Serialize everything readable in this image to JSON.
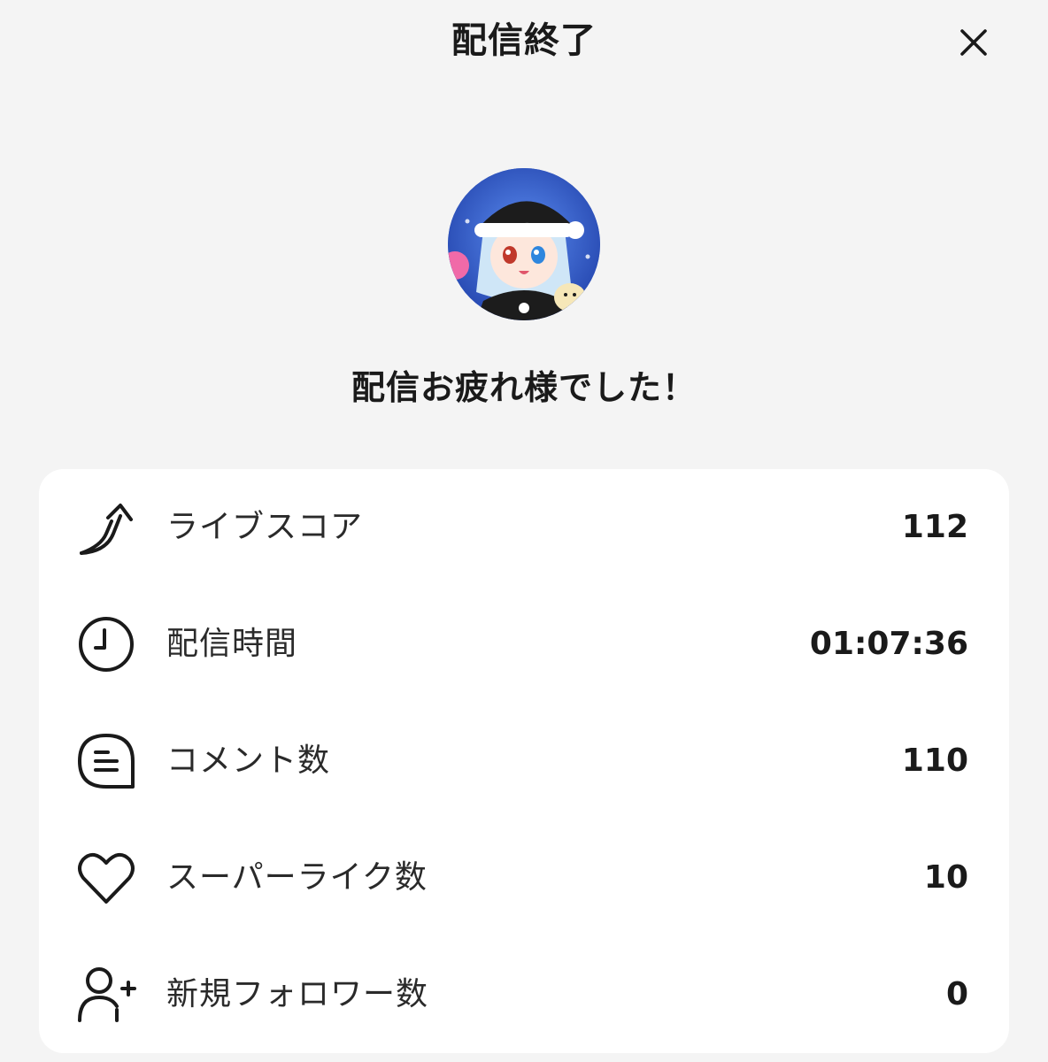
{
  "header": {
    "title": "配信終了",
    "close_icon": "close-icon"
  },
  "avatar": {
    "description_icon": "avatar-image"
  },
  "message": "配信お疲れ様でした！",
  "stats": [
    {
      "icon": "live-score-arrow-icon",
      "label": "ライブスコア",
      "value": "112"
    },
    {
      "icon": "clock-icon",
      "label": "配信時間",
      "value": "01:07:36"
    },
    {
      "icon": "comment-icon",
      "label": "コメント数",
      "value": "110"
    },
    {
      "icon": "heart-icon",
      "label": "スーパーライク数",
      "value": "10"
    },
    {
      "icon": "add-user-icon",
      "label": "新規フォロワー数",
      "value": "0"
    }
  ],
  "colors": {
    "background": "#f4f4f4",
    "card": "#ffffff",
    "text": "#1a1a1a"
  }
}
